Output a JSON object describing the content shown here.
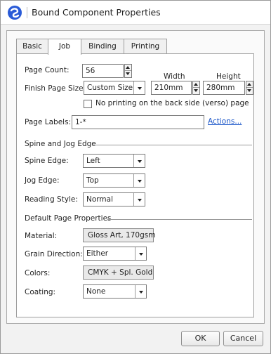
{
  "window": {
    "title": "Bound Component Properties"
  },
  "tabs": [
    {
      "label": "Basic"
    },
    {
      "label": "Job"
    },
    {
      "label": "Binding"
    },
    {
      "label": "Printing"
    }
  ],
  "job": {
    "page_count_label": "Page Count:",
    "page_count_value": "56",
    "width_label": "Width",
    "height_label": "Height",
    "finish_size_label": "Finish Page Size:",
    "finish_size_value": "Custom Size",
    "width_value": "210mm",
    "height_value": "280mm",
    "no_back_print_label": "No printing on the back side (verso) page",
    "no_back_print_checked": false,
    "page_labels_label": "Page Labels:",
    "page_labels_value": "1-*",
    "actions_link": "Actions...",
    "spine_section": "Spine and Jog Edge",
    "spine_edge_label": "Spine Edge:",
    "spine_edge_value": "Left",
    "jog_edge_label": "Jog Edge:",
    "jog_edge_value": "Top",
    "reading_style_label": "Reading Style:",
    "reading_style_value": "Normal",
    "default_section": "Default Page Properties",
    "material_label": "Material:",
    "material_value": "Gloss Art, 170gsm",
    "grain_label": "Grain Direction:",
    "grain_value": "Either",
    "colors_label": "Colors:",
    "colors_value": "CMYK + Spl. Gold",
    "coating_label": "Coating:",
    "coating_value": "None"
  },
  "footer": {
    "ok_label": "OK",
    "cancel_label": "Cancel"
  },
  "colors": {
    "accent": "#1a55c8",
    "app_icon": "#2a5bd7"
  }
}
